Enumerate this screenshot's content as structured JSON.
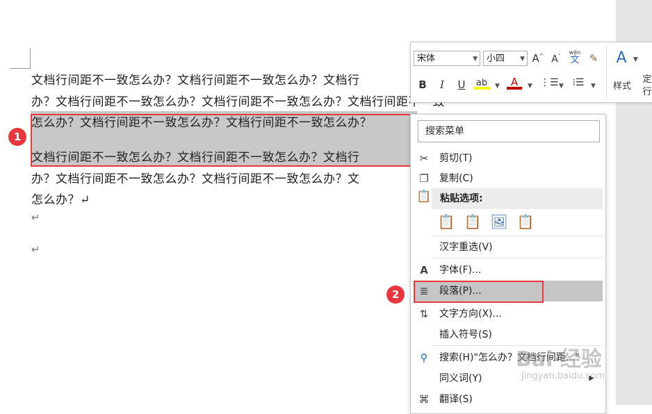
{
  "document": {
    "lines": [
      "文档行间距不一致怎么办？文档行间距不一致怎么办？文档行",
      "办？文档行间距不一致怎么办？文档行间距不一致怎么办？文档行间距不一致",
      "怎么办？文档行间距不一致怎么办？文档行间距不一致怎么办？",
      "文档行间距不一致怎么办？文档行间距不一致怎么办？文档行",
      "办？文档行间距不一致怎么办？文档行间距不一致怎么办？文",
      "怎么办？↵"
    ],
    "paragraph_marks": [
      "↵",
      "↵"
    ]
  },
  "annotations": {
    "step1": "1",
    "step2": "2"
  },
  "mini_toolbar": {
    "font_name": "宋体",
    "font_size": "小四",
    "grow_font": "A",
    "shrink_font": "A",
    "phonetic_guide": "文",
    "phonetic_top": "wén",
    "bold": "B",
    "italic": "I",
    "underline": "U",
    "highlight": "ab",
    "font_color": "A",
    "styles_label": "样式",
    "line_spacing_label": "定",
    "line_spacing_label2": "行",
    "brand_color_font": "#c00000",
    "highlight_color": "#ffff00"
  },
  "context_menu": {
    "search_placeholder": "搜索菜单",
    "cut": "剪切(T)",
    "copy": "复制(C)",
    "paste_options": "粘贴选项:",
    "reconvert": "汉字重选(V)",
    "font": "字体(F)...",
    "paragraph": "段落(P)...",
    "text_direction": "文字方向(X)...",
    "insert_symbol": "插入符号(S)",
    "search": "搜索(H)\"怎么办？文档行间距...\"",
    "synonyms": "同义词(Y)",
    "translate": "翻译(S)"
  },
  "watermark": {
    "brand": "Bai 经验",
    "url": "jingyan.baidu.com"
  }
}
